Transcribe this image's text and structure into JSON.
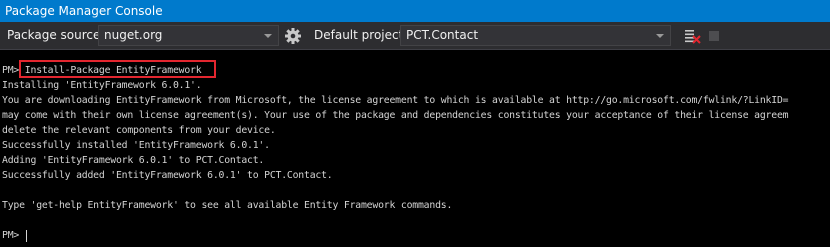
{
  "window": {
    "title": "Package Manager Console"
  },
  "toolbar": {
    "package_source_label": "Package source:",
    "package_source_value": "nuget.org",
    "default_project_label": "Default project:",
    "default_project_value": "PCT.Contact",
    "icons": {
      "settings": "gear-icon",
      "clear": "clear-console-icon",
      "stop": "stop-icon"
    }
  },
  "console": {
    "lines": [
      "PM> Install-Package EntityFramework",
      "Installing 'EntityFramework 6.0.1'.",
      "You are downloading EntityFramework from Microsoft, the license agreement to which is available at http://go.microsoft.com/fwlink/?LinkID=",
      "may come with their own license agreement(s). Your use of the package and dependencies constitutes your acceptance of their license agreem",
      "delete the relevant components from your device.",
      "Successfully installed 'EntityFramework 6.0.1'.",
      "Adding 'EntityFramework 6.0.1' to PCT.Contact.",
      "Successfully added 'EntityFramework 6.0.1' to PCT.Contact.",
      "",
      "Type 'get-help EntityFramework' to see all available Entity Framework commands.",
      "",
      "PM> "
    ]
  },
  "colors": {
    "title_bar": "#007acc",
    "toolbar": "#2d2d30",
    "console_bg": "#000000",
    "console_text": "#d4d4d4",
    "highlight_border": "#e3262f"
  }
}
